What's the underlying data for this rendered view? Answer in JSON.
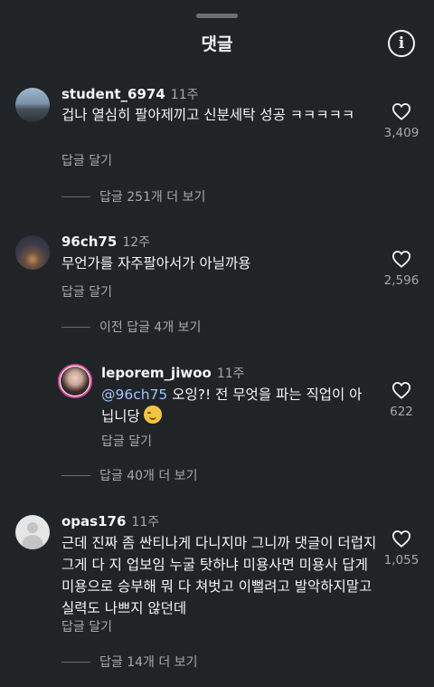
{
  "header": {
    "title": "댓글",
    "info_icon": "info-icon"
  },
  "comments": [
    {
      "username": "student_6974",
      "time": "11주",
      "text": "겁나 열심히 팔아제끼고 신분세탁 성공 ㅋㅋㅋㅋㅋ",
      "reply_label": "답글 달기",
      "like_count": "3,409",
      "more_label": "답글 251개 더 보기"
    },
    {
      "username": "96ch75",
      "time": "12주",
      "text": "무언가를 자주팔아서가 아닐까용",
      "reply_label": "답글 달기",
      "like_count": "2,596",
      "more_label": "이전 답글 4개 보기"
    },
    {
      "username": "leporem_jiwoo",
      "time": "11주",
      "mention": "@96ch75",
      "text": " 오잉?! 전 무엇을 파는 직업이 아닙니당",
      "reply_label": "답글 달기",
      "like_count": "622",
      "more_label": "답글 40개 더 보기"
    },
    {
      "username": "opas176",
      "time": "11주",
      "text": "근데 진짜 좀 싼티나게 다니지마 그니까 댓글이 더럽지 그게 다 지 업보임 누굴 탓하냐 미용사면 미용사 답게 미용으로 승부해 뭐 다 쳐벗고 이뻘려고 발악하지말고 실력도 나쁘지 않던데",
      "reply_label": "답글 달기",
      "like_count": "1,055",
      "more_label": "답글 14개 더 보기"
    }
  ]
}
